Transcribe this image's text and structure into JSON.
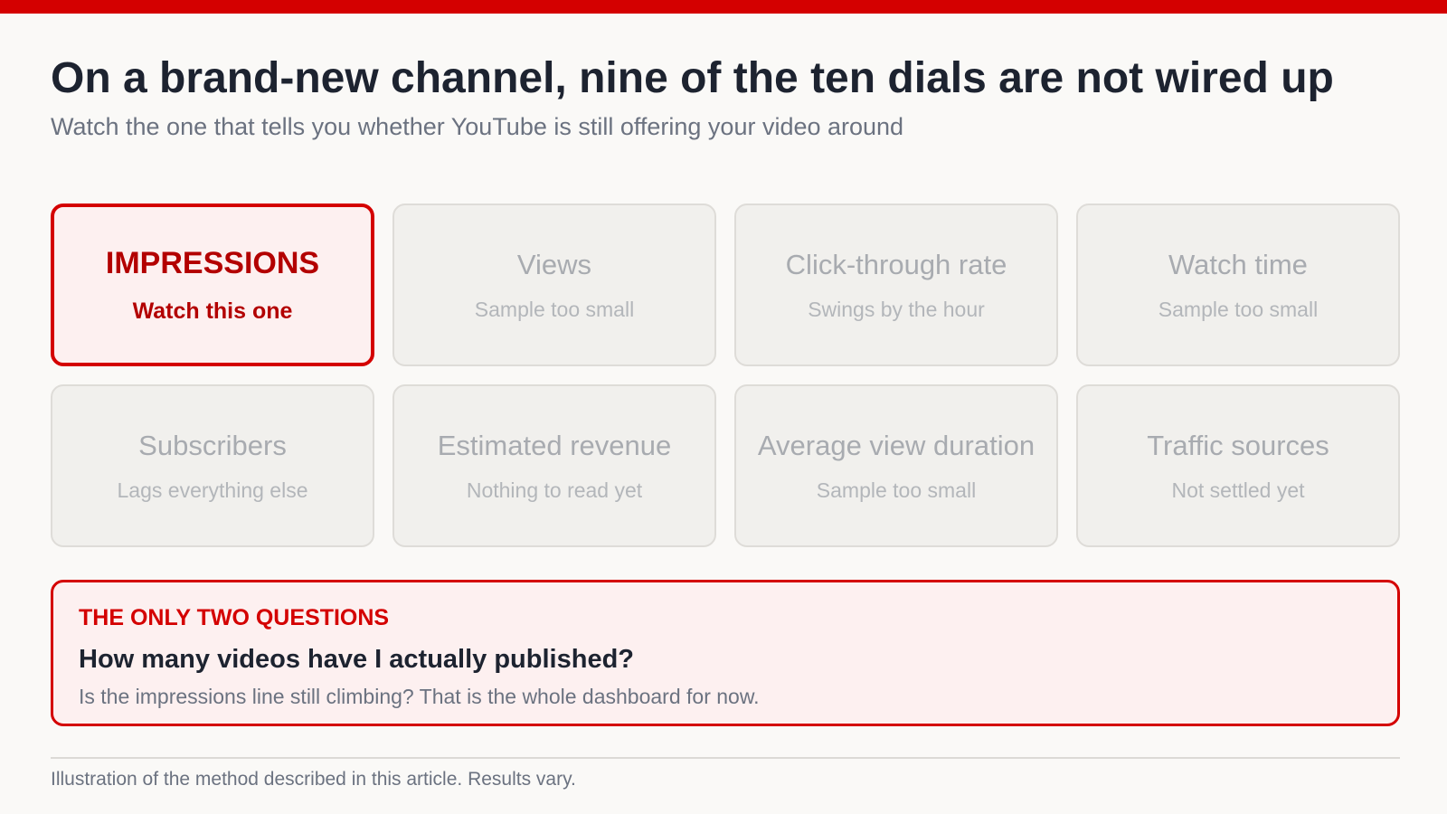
{
  "header": {
    "title": "On a brand-new channel, nine of the ten dials are not wired up",
    "subtitle": "Watch the one that tells you whether YouTube is still offering your video around"
  },
  "metrics": [
    {
      "title": "IMPRESSIONS",
      "note": "Watch this one",
      "highlight": true
    },
    {
      "title": "Views",
      "note": "Sample too small",
      "highlight": false
    },
    {
      "title": "Click-through rate",
      "note": "Swings by the hour",
      "highlight": false
    },
    {
      "title": "Watch time",
      "note": "Sample too small",
      "highlight": false
    },
    {
      "title": "Subscribers",
      "note": "Lags everything else",
      "highlight": false
    },
    {
      "title": "Estimated revenue",
      "note": "Nothing to read yet",
      "highlight": false
    },
    {
      "title": "Average view duration",
      "note": "Sample too small",
      "highlight": false
    },
    {
      "title": "Traffic sources",
      "note": "Not settled yet",
      "highlight": false
    }
  ],
  "callout": {
    "eyebrow": "THE ONLY TWO QUESTIONS",
    "question": "How many videos have I actually published?",
    "body": "Is the impressions line still climbing? That is the whole dashboard for now."
  },
  "footer": {
    "note": "Illustration of the method described in this article. Results vary."
  },
  "colors": {
    "accent": "#d40000",
    "highlight_text": "#b30000",
    "highlight_bg": "#fdf0f0",
    "muted_card_bg": "#f1f0ed",
    "muted_text": "#a8abb0",
    "title_text": "#1d2330",
    "page_bg": "#faf9f7"
  }
}
